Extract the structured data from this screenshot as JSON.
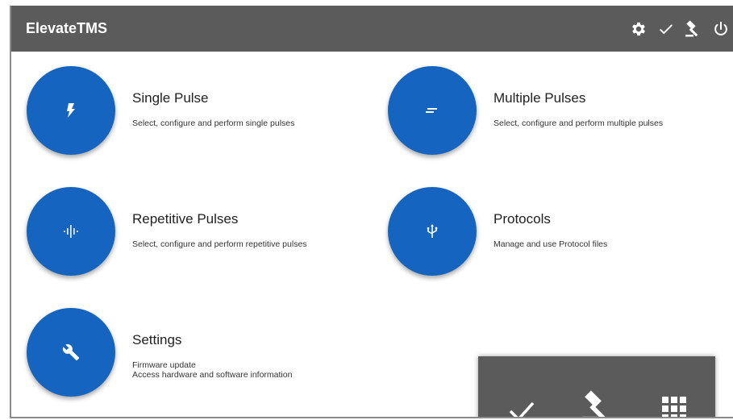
{
  "app": {
    "title": "ElevateTMS"
  },
  "header_icons": [
    "gear-icon",
    "check-icon",
    "gavel-icon",
    "power-icon"
  ],
  "menu": [
    {
      "title": "Single Pulse",
      "description": [
        "Select, configure and perform single pulses"
      ],
      "icon": "bolt-icon"
    },
    {
      "title": "Multiple Pulses",
      "description": [
        "Select, configure and perform multiple pulses"
      ],
      "icon": "bars-icon"
    },
    {
      "title": "Repetitive Pulses",
      "description": [
        "Select, configure and perform repetitive pulses"
      ],
      "icon": "waveform-icon"
    },
    {
      "title": "Protocols",
      "description": [
        "Manage and use Protocol files"
      ],
      "icon": "usb-icon"
    },
    {
      "title": "Settings",
      "description": [
        "Firmware update",
        "Access hardware and software information"
      ],
      "icon": "wrench-icon"
    }
  ],
  "bottom_panel_icons": [
    "check-icon",
    "gavel-icon",
    "grid-icon"
  ],
  "colors": {
    "topbar": "#5b5b5b",
    "accent": "#1565c0",
    "panel": "#5b5b5b"
  }
}
